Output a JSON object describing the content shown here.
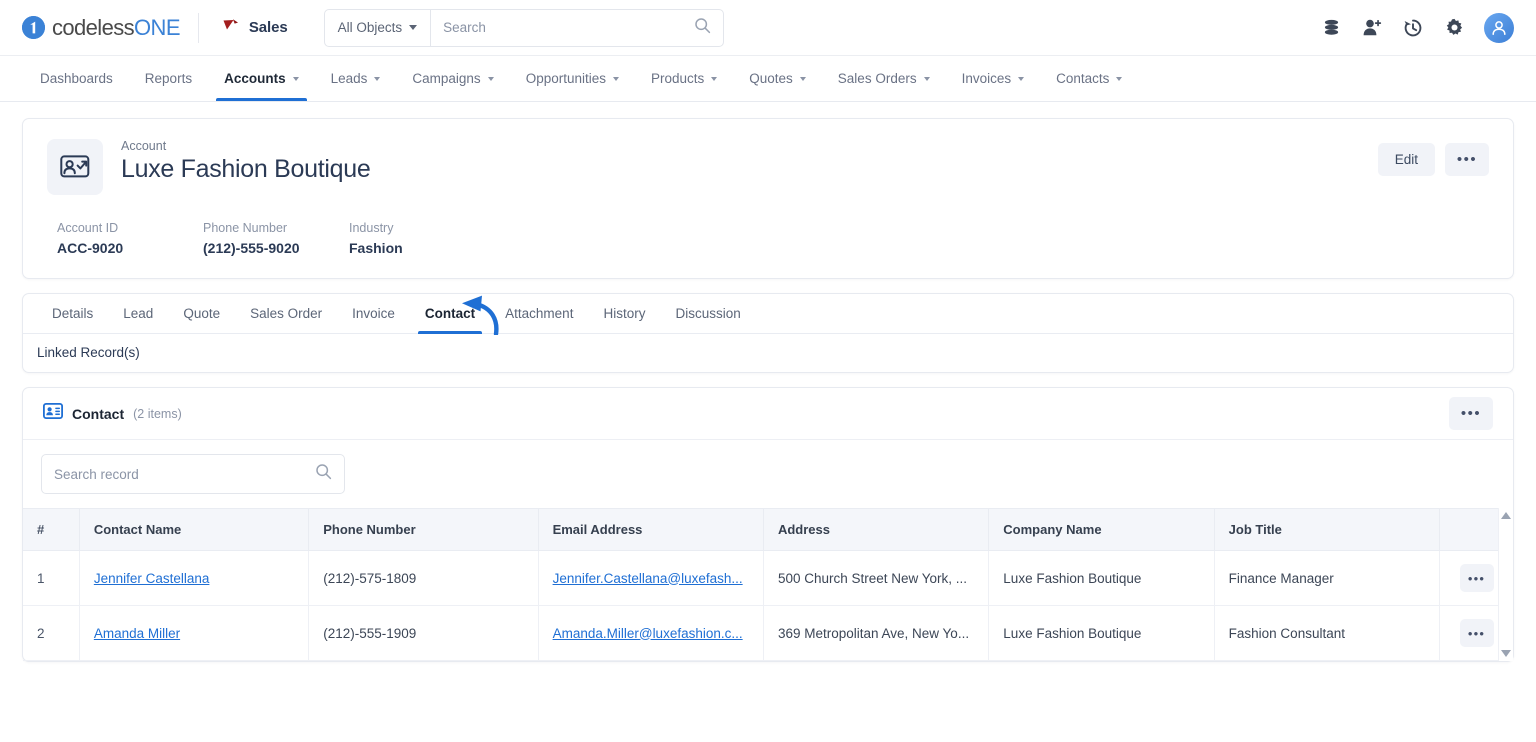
{
  "brand": {
    "logo_text_a": "codeless",
    "logo_text_b": "ONE",
    "logo_icon": "codelessone-logo-icon",
    "accent": "#1f6fd4",
    "logo_blue": "#3b82d6"
  },
  "topbar": {
    "app_name": "Sales",
    "app_icon": "sales-app-icon",
    "object_filter": "All Objects",
    "search_placeholder": "Search",
    "search_value": "",
    "icons": [
      {
        "name": "database-icon",
        "title": "Data"
      },
      {
        "name": "add-user-icon",
        "title": "Add User"
      },
      {
        "name": "history-icon",
        "title": "History"
      },
      {
        "name": "gear-icon",
        "title": "Settings"
      },
      {
        "name": "avatar-icon",
        "title": "Profile"
      }
    ]
  },
  "nav": {
    "items": [
      {
        "label": "Dashboards",
        "has_caret": false,
        "active": false
      },
      {
        "label": "Reports",
        "has_caret": false,
        "active": false
      },
      {
        "label": "Accounts",
        "has_caret": true,
        "active": true
      },
      {
        "label": "Leads",
        "has_caret": true,
        "active": false
      },
      {
        "label": "Campaigns",
        "has_caret": true,
        "active": false
      },
      {
        "label": "Opportunities",
        "has_caret": true,
        "active": false
      },
      {
        "label": "Products",
        "has_caret": true,
        "active": false
      },
      {
        "label": "Quotes",
        "has_caret": true,
        "active": false
      },
      {
        "label": "Sales Orders",
        "has_caret": true,
        "active": false
      },
      {
        "label": "Invoices",
        "has_caret": true,
        "active": false
      },
      {
        "label": "Contacts",
        "has_caret": true,
        "active": false
      }
    ]
  },
  "record": {
    "object_label": "Account",
    "title": "Luxe Fashion Boutique",
    "icon": "account-card-icon",
    "edit_label": "Edit",
    "more_label": "•••",
    "meta": [
      {
        "key": "Account ID",
        "value": "ACC-9020"
      },
      {
        "key": "Phone Number",
        "value": "(212)-555-9020"
      },
      {
        "key": "Industry",
        "value": "Fashion"
      }
    ]
  },
  "tabs": {
    "items": [
      {
        "label": "Details",
        "active": false
      },
      {
        "label": "Lead",
        "active": false
      },
      {
        "label": "Quote",
        "active": false
      },
      {
        "label": "Sales Order",
        "active": false
      },
      {
        "label": "Invoice",
        "active": false
      },
      {
        "label": "Contact",
        "active": true
      },
      {
        "label": "Attachment",
        "active": false
      },
      {
        "label": "History",
        "active": false
      },
      {
        "label": "Discussion",
        "active": false
      }
    ],
    "linked_records_label": "Linked Record(s)"
  },
  "panel": {
    "icon": "contact-card-icon",
    "title": "Contact",
    "count_label": "(2 items)",
    "more_label": "•••",
    "search_placeholder": "Search record",
    "search_value": ""
  },
  "table": {
    "columns": [
      "#",
      "Contact Name",
      "Phone Number",
      "Email Address",
      "Address",
      "Company Name",
      "Job Title",
      ""
    ],
    "rows": [
      {
        "num": "1",
        "contact_name": "Jennifer Castellana",
        "phone": "(212)-575-1809",
        "email": "Jennifer.Castellana@luxefash...",
        "address": "500 Church Street New York, ...",
        "company": "Luxe Fashion Boutique",
        "job_title": "Finance Manager",
        "row_more": "•••"
      },
      {
        "num": "2",
        "contact_name": "Amanda Miller",
        "phone": "(212)-555-1909",
        "email": "Amanda.Miller@luxefashion.c...",
        "address": "369 Metropolitan Ave, New Yo...",
        "company": "Luxe Fashion Boutique",
        "job_title": "Fashion Consultant",
        "row_more": "•••"
      }
    ],
    "scroll_up_icon": "scroll-up-arrow-icon",
    "scroll_down_icon": "scroll-down-arrow-icon"
  },
  "annotation": {
    "type": "curved-arrow",
    "color": "#1f6fd4",
    "points_to": "Contact"
  }
}
